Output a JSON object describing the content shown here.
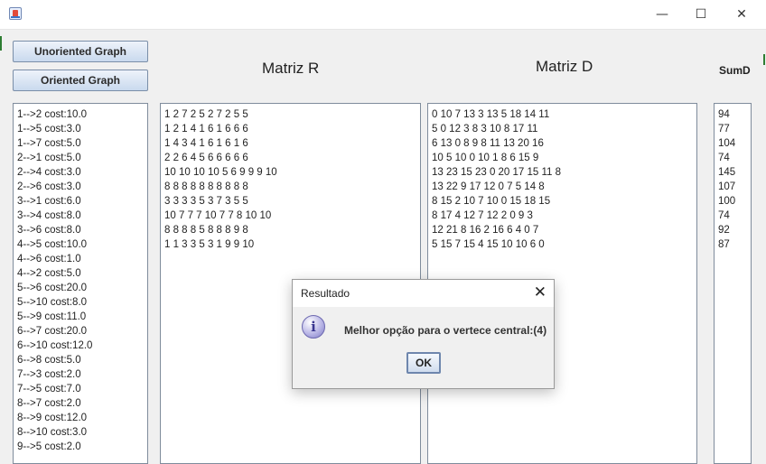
{
  "window": {
    "minimize_glyph": "—",
    "maximize_glyph": "☐",
    "close_glyph": "✕"
  },
  "buttons": {
    "unoriented": "Unoriented Graph",
    "oriented": "Oriented Graph"
  },
  "columns": {
    "matriz_r": "Matriz R",
    "matriz_d": "Matriz D",
    "sumd": "SumD"
  },
  "edges": [
    "1-->2 cost:10.0",
    "1-->5 cost:3.0",
    "1-->7 cost:5.0",
    "2-->1 cost:5.0",
    "2-->4 cost:3.0",
    "2-->6 cost:3.0",
    "3-->1 cost:6.0",
    "3-->4 cost:8.0",
    "3-->6 cost:8.0",
    "4-->5 cost:10.0",
    "4-->6 cost:1.0",
    "4-->2 cost:5.0",
    "5-->6 cost:20.0",
    "5-->10 cost:8.0",
    "5-->9 cost:11.0",
    "6-->7 cost:20.0",
    "6-->10 cost:12.0",
    "6-->8 cost:5.0",
    "7-->3 cost:2.0",
    "7-->5 cost:7.0",
    "8-->7 cost:2.0",
    "8-->9 cost:12.0",
    "8-->10 cost:3.0",
    "9-->5 cost:2.0"
  ],
  "matriz_r": [
    "1 2 7 2 5 2 7 2 5 5",
    "1 2 1 4 1 6 1 6 6 6",
    "1 4 3 4 1 6 1 6 1 6",
    "2 2 6 4 5 6 6 6 6 6",
    "10 10 10 10 5 6 9 9 9 10",
    "8 8 8 8 8 8 8 8 8 8",
    "3 3 3 3 5 3 7 3 5 5",
    "10 7 7 7 10 7 7 8 10 10",
    "8 8 8 8 5 8 8 8 9 8",
    "1 1 3 3 5 3 1 9 9 10"
  ],
  "matriz_d": [
    "0 10 7 13 3 13 5 18 14 11",
    "5 0 12 3 8 3 10 8 17 11",
    "6 13 0 8 9 8 11 13 20 16",
    "10 5 10 0 10 1 8 6 15 9",
    "13 23 15 23 0 20 17 15 11 8",
    "13 22 9 17 12 0 7 5 14 8",
    "8 15 2 10 7 10 0 15 18 15",
    "8 17 4 12 7 12 2 0 9 3",
    "12 21 8 16 2 16 6 4 0 7",
    "5 15 7 15 4 15 10 10 6 0"
  ],
  "sumd": [
    "94",
    "77",
    "104",
    "74",
    "145",
    "107",
    "100",
    "74",
    "92",
    "87"
  ],
  "dialog": {
    "title": "Resultado",
    "close_glyph": "✕",
    "info_glyph": "i",
    "message": "Melhor opção para o vertece central:(4)",
    "ok_label": "OK"
  },
  "colors": {
    "button_border": "#7a8ea8",
    "panel_border": "#7f8c9c",
    "info_icon": "#7f7bc6"
  }
}
